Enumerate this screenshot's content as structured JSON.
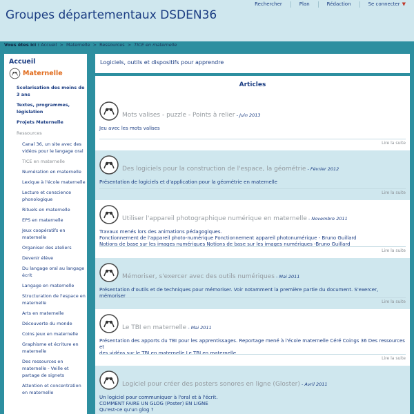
{
  "site": {
    "title": "Groupes départementaux DSDEN36"
  },
  "topnav": {
    "rechercher": "Rechercher",
    "plan": "Plan",
    "redaction": "Rédaction",
    "connect": "Se connecter",
    "caret": "▼"
  },
  "breadcrumb": {
    "prefix": "Vous êtes ici :",
    "items": [
      "Accueil",
      "Maternelle",
      "Ressources"
    ],
    "separator": ">",
    "current": "TICE en maternelle"
  },
  "sidebar": {
    "accueil": "Accueil",
    "maternelle": "Maternelle",
    "top_items": [
      "Scolarisation des moins de 3 ans",
      "Textes, programmes, législation",
      "Projets Maternelle"
    ],
    "ressources_label": "Ressources",
    "sub_items": [
      "Canal 36, un site avec des vidéos pour le langage oral",
      "TICE en maternelle",
      "Numération en maternelle",
      "Lexique à l'école maternelle",
      "Lecture et conscience phonologique",
      "Rituels en maternelle",
      "EPS en maternelle",
      "Jeux coopératifs en maternelle",
      "Organiser des ateliers",
      "Devenir élève",
      "Du langage oral au langage écrit",
      "Langage en maternelle",
      "Structuration de l'espace en maternelle",
      "Arts en maternelle",
      "Découverte du monde",
      "Coins jeux en maternelle",
      "Graphisme et écriture en maternelle",
      "Des ressources en maternelle - Veille et partage de signets",
      "Attention et concentration en maternelle"
    ]
  },
  "topcard": {
    "text": "Logiciels, outils et dispositifs pour apprendre"
  },
  "main": {
    "heading": "Articles",
    "more_label": "Lire la suite",
    "articles": [
      {
        "title": "Mots valises - puzzle - Points à relier",
        "date": "Juin 2013",
        "lines": [
          "Jeu avec les mots valises"
        ]
      },
      {
        "title": "Des logiciels pour la construction de l'espace, la géométrie",
        "date": "Février 2012",
        "lines": [
          "Présentation de logiciels et d'application pour la géométrie en maternelle"
        ]
      },
      {
        "title": "Utiliser l'appareil photographique numérique en maternelle",
        "date": "Novembre 2011",
        "lines": [
          "Travaux menés lors des animations pédagogiques.",
          "Fonctionnement de l'appareil photo-numérique Fonctionnement appareil photonumérique - Bruno Guillard",
          "Notions de base sur les images numériques Notions de base sur les images numériques -Bruno Guillard"
        ]
      },
      {
        "title": "Mémoriser, s'exercer avec des outils numériques",
        "date": "Mai 2011",
        "lines": [
          "Présentation d'outils et de techniques pour mémoriser. Voir notamment la première partie du document. S'exercer, mémoriser"
        ]
      },
      {
        "title": "Le TBI en maternelle",
        "date": "Mai 2011",
        "lines": [
          "Présentation des apports du TBI pour les apprentissages. Reportage mené à l'école maternelle Céré Coings 36 Des ressources et",
          "des vidéos sur le TBI en maternelle Le TBI en maternelle"
        ]
      },
      {
        "title": "Logiciel pour créer des posters sonores en ligne (Gloster)",
        "date": "Avril 2011",
        "lines": [
          "Un logiciel pour communiquer à l'oral et à l'écrit.",
          "COMMENT FAIRE UN GLOG (Poster) EN LIGNE",
          "Qu'est-ce qu'un glog ?"
        ]
      }
    ]
  }
}
